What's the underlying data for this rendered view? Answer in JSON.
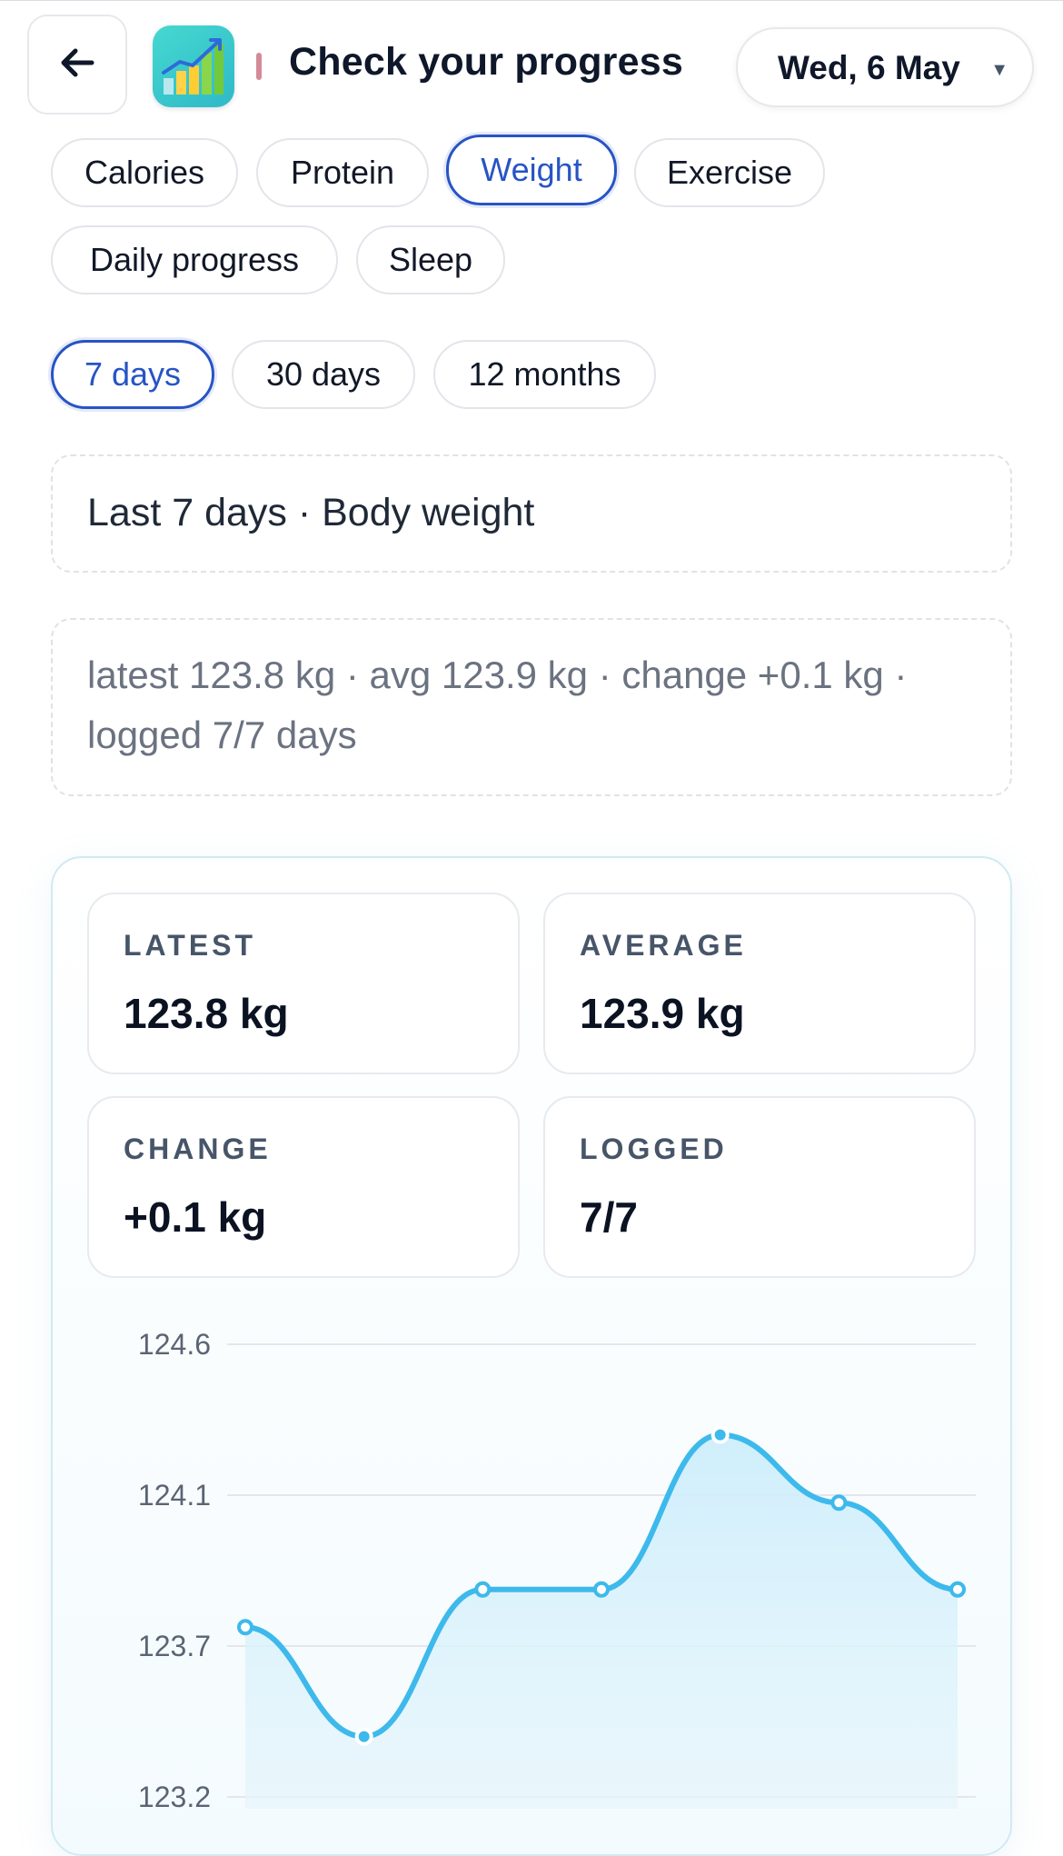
{
  "header": {
    "title": "Check your progress",
    "date": "Wed, 6 May",
    "back_icon": "arrow-left-icon",
    "app_icon": "chart-growth-icon"
  },
  "metric_tabs": [
    {
      "label": "Calories",
      "active": false
    },
    {
      "label": "Protein",
      "active": false
    },
    {
      "label": "Weight",
      "active": true
    },
    {
      "label": "Exercise",
      "active": false
    },
    {
      "label": "Daily progress",
      "active": false
    },
    {
      "label": "Sleep",
      "active": false
    }
  ],
  "range_tabs": [
    {
      "label": "7 days",
      "active": true
    },
    {
      "label": "30 days",
      "active": false
    },
    {
      "label": "12 months",
      "active": false
    }
  ],
  "range_title": "Last 7 days · Body weight",
  "summary": "latest 123.8 kg · avg 123.9 kg · change +0.1 kg · logged 7/7 days",
  "stats": [
    {
      "label": "LATEST",
      "value": "123.8 kg"
    },
    {
      "label": "AVERAGE",
      "value": "123.9 kg"
    },
    {
      "label": "CHANGE",
      "value": "+0.1 kg"
    },
    {
      "label": "LOGGED",
      "value": "7/7"
    }
  ],
  "colors": {
    "accent": "#2754c5",
    "line": "#3db9ec",
    "fill": "#d6effb"
  },
  "chart_data": {
    "type": "area",
    "y_ticks": [
      "124.6",
      "124.1",
      "123.7",
      "123.2"
    ],
    "ylim": [
      123.2,
      124.6
    ],
    "grid": true,
    "series": [
      {
        "values": [
          123.75,
          123.4,
          123.85,
          123.85,
          124.3,
          124.08,
          123.85
        ]
      }
    ]
  }
}
